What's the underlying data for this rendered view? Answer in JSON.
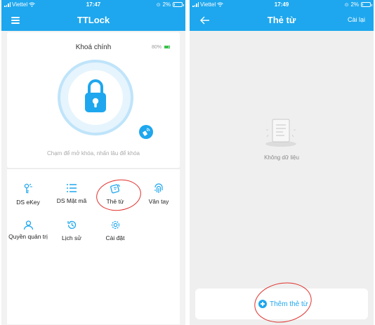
{
  "screen_main": {
    "status": {
      "carrier": "Viettel",
      "time": "17:47",
      "battery": "2%"
    },
    "title": "TTLock",
    "lock_name": "Khoá chính",
    "battery_level": "80%",
    "hint": "Chạm để mở khóa, nhấn lâu để khóa",
    "menu": [
      {
        "label": "DS eKey",
        "icon": "key-person-icon"
      },
      {
        "label": "DS Mật mã",
        "icon": "password-list-icon"
      },
      {
        "label": "Thẻ từ",
        "icon": "card-icon"
      },
      {
        "label": "Vân tay",
        "icon": "fingerprint-icon"
      },
      {
        "label": "Quyền quản trị",
        "icon": "admin-icon"
      },
      {
        "label": "Lịch sử",
        "icon": "history-icon"
      },
      {
        "label": "Cài đặt",
        "icon": "settings-icon"
      }
    ]
  },
  "screen_card": {
    "status": {
      "carrier": "Viettel",
      "time": "17:49",
      "battery": "2%"
    },
    "title": "Thẻ từ",
    "reset": "Cài lại",
    "empty": "Không dữ liệu",
    "add_button": "Thêm thẻ từ"
  },
  "colors": {
    "accent": "#1ea7ee",
    "annotation": "#e0302b"
  }
}
